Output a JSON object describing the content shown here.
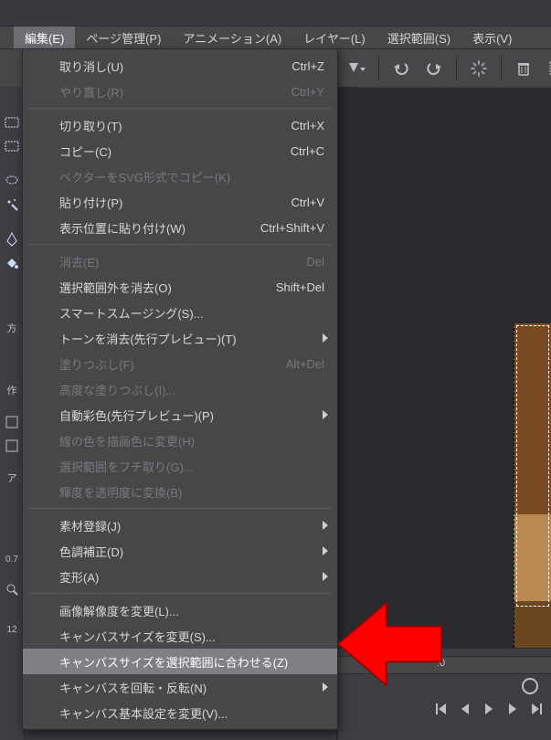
{
  "menubar": {
    "edit": "編集(E)",
    "page": "ページ管理(P)",
    "animation": "アニメーション(A)",
    "layer": "レイヤー(L)",
    "selection": "選択範囲(S)",
    "view": "表示(V)"
  },
  "left_labels": {
    "direction": "方",
    "make": "作",
    "a": "ア",
    "zoom": "0.7",
    "twelve": "12"
  },
  "timeline": {
    "origin": ".0"
  },
  "menu": {
    "items": [
      {
        "label": "取り消し(U)",
        "accel": "Ctrl+Z",
        "disabled": false
      },
      {
        "label": "やり直し(R)",
        "accel": "Ctrl+Y",
        "disabled": true
      },
      {
        "sep": true
      },
      {
        "label": "切り取り(T)",
        "accel": "Ctrl+X",
        "disabled": false
      },
      {
        "label": "コピー(C)",
        "accel": "Ctrl+C",
        "disabled": false
      },
      {
        "label": "ベクターをSVG形式でコピー(K)",
        "accel": "",
        "disabled": true
      },
      {
        "label": "貼り付け(P)",
        "accel": "Ctrl+V",
        "disabled": false
      },
      {
        "label": "表示位置に貼り付け(W)",
        "accel": "Ctrl+Shift+V",
        "disabled": false
      },
      {
        "sep": true
      },
      {
        "label": "消去(E)",
        "accel": "Del",
        "disabled": true
      },
      {
        "label": "選択範囲外を消去(O)",
        "accel": "Shift+Del",
        "disabled": false
      },
      {
        "label": "スマートスムージング(S)...",
        "accel": "",
        "disabled": false
      },
      {
        "label": "トーンを消去(先行プレビュー)(T)",
        "accel": "",
        "disabled": false,
        "submenu": true
      },
      {
        "label": "塗りつぶし(F)",
        "accel": "Alt+Del",
        "disabled": true
      },
      {
        "label": "高度な塗りつぶし(I)...",
        "accel": "",
        "disabled": true
      },
      {
        "label": "自動彩色(先行プレビュー)(P)",
        "accel": "",
        "disabled": false,
        "submenu": true
      },
      {
        "label": "線の色を描画色に変更(H)",
        "accel": "",
        "disabled": true
      },
      {
        "label": "選択範囲をフチ取り(G)...",
        "accel": "",
        "disabled": true
      },
      {
        "label": "輝度を透明度に変換(B)",
        "accel": "",
        "disabled": true
      },
      {
        "sep": true
      },
      {
        "label": "素材登録(J)",
        "accel": "",
        "disabled": false,
        "submenu": true
      },
      {
        "label": "色調補正(D)",
        "accel": "",
        "disabled": false,
        "submenu": true
      },
      {
        "label": "変形(A)",
        "accel": "",
        "disabled": false,
        "submenu": true
      },
      {
        "sep": true
      },
      {
        "label": "画像解像度を変更(L)...",
        "accel": "",
        "disabled": false
      },
      {
        "label": "キャンバスサイズを変更(S)...",
        "accel": "",
        "disabled": false
      },
      {
        "label": "キャンバスサイズを選択範囲に合わせる(Z)",
        "accel": "",
        "disabled": false,
        "highlight": true
      },
      {
        "label": "キャンバスを回転・反転(N)",
        "accel": "",
        "disabled": false,
        "submenu": true
      },
      {
        "label": "キャンバス基本設定を変更(V)...",
        "accel": "",
        "disabled": false
      }
    ]
  }
}
